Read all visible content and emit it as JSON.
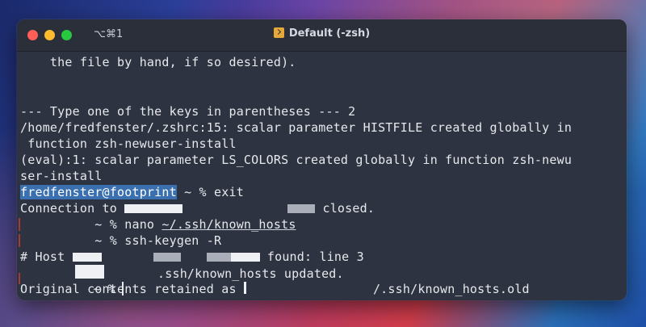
{
  "window": {
    "shortcut": "⌥⌘1",
    "title": "Default (-zsh)"
  },
  "terminal": {
    "l1": "    the file by hand, if so desired).",
    "l3": "--- Type one of the keys in parentheses --- 2",
    "l4": "/home/fredfenster/.zshrc:15: scalar parameter HISTFILE created globally in",
    "l5": " function zsh-newuser-install",
    "l6": "(eval):1: scalar parameter LS_COLORS created globally in function zsh-newu",
    "l7": "ser-install",
    "l8_user": "fredfenster@footprint",
    "l8_rest": " ~ % exit",
    "l9_a": "Connection to ",
    "l9_b": " closed.",
    "l10_prompt": "          ~ % nano ",
    "l10_arg": "~/.ssh/known_hosts",
    "l11": "          ~ % ssh-keygen -R",
    "l12_a": "# Host ",
    "l12_b": " found: line 3",
    "l13": ".ssh/known_hosts updated.",
    "l14_a": "Original contents retained as ",
    "l14_b": "/.ssh/known_hosts.old",
    "l15": "          ~ % "
  }
}
